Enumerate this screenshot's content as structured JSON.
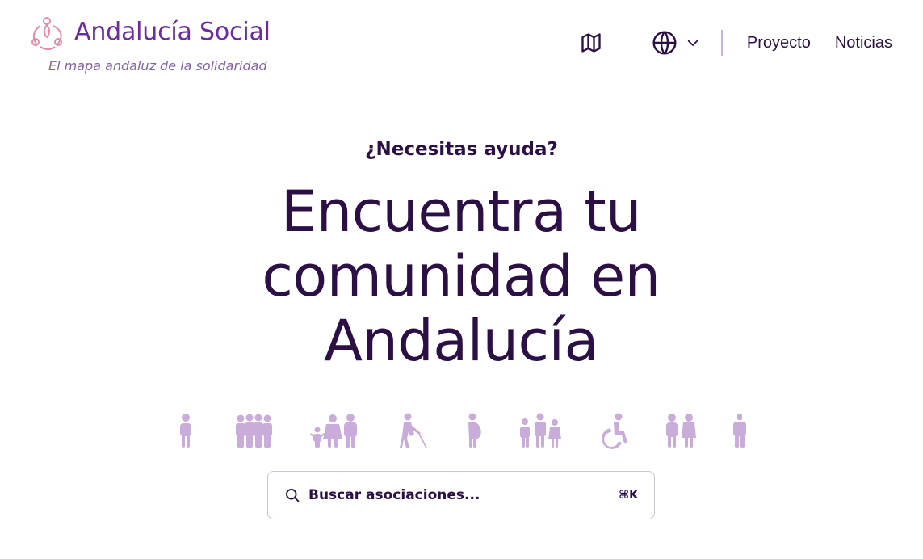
{
  "header": {
    "brand": "Andalucía Social",
    "tagline": "El mapa andaluz de la solidaridad",
    "nav": {
      "map_icon": "map-icon",
      "language_icon": "globe-icon",
      "language_chevron": "chevron-down-icon",
      "links": [
        "Proyecto",
        "Noticias"
      ]
    }
  },
  "hero": {
    "kicker": "¿Necesitas ayuda?",
    "title": "Encuentra tu comunidad en Andalucía"
  },
  "figures": [
    "person-icon",
    "group-icon",
    "family-icon",
    "blind-person-icon",
    "pregnant-person-icon",
    "children-group-icon",
    "wheelchair-icon",
    "couple-icon",
    "child-icon"
  ],
  "search": {
    "placeholder": "Buscar asociaciones...",
    "shortcut": "⌘K"
  },
  "colors": {
    "brand": "#6e2b9d",
    "text": "#2b0f45",
    "figure": "#c9acd9",
    "logo_pink": "#e68aa8"
  }
}
